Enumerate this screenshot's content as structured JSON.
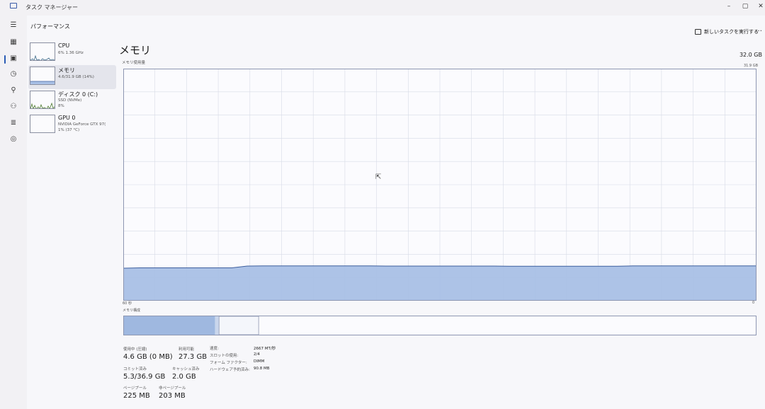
{
  "window": {
    "title": "タスク マネージャー",
    "minimize": "–",
    "maximize": "▢",
    "close": "✕"
  },
  "header": {
    "section": "パフォーマンス",
    "run_task": "新しいタスクを実行する",
    "more": "…"
  },
  "sidebar": {
    "items": [
      {
        "name": "CPU",
        "sub1": "6% 1.36 GHz",
        "sub2": ""
      },
      {
        "name": "メモリ",
        "sub1": "4.6/31.9 GB (14%)",
        "sub2": ""
      },
      {
        "name": "ディスク 0 (C:)",
        "sub1": "SSD (NVMe)",
        "sub2": "8%"
      },
      {
        "name": "GPU 0",
        "sub1": "NVIDIA GeForce GTX 97(",
        "sub2": "1% (37 °C)"
      }
    ]
  },
  "main": {
    "title": "メモリ",
    "usage_label": "メモリ使用量",
    "total": "32.0 GB",
    "max": "31.9 GB",
    "axis_left": "60 秒",
    "axis_right": "0",
    "composition_label": "メモリ構成"
  },
  "stats": {
    "in_use_label": "使用中 (圧縮)",
    "in_use_value": "4.6 GB (0 MB)",
    "available_label": "利用可能",
    "available_value": "27.3 GB",
    "committed_label": "コミット済み",
    "committed_value": "5.3/36.9 GB",
    "cached_label": "キャッシュ済み",
    "cached_value": "2.0 GB",
    "paged_label": "ページプール",
    "paged_value": "225 MB",
    "nonpaged_label": "非ページプール",
    "nonpaged_value": "203 MB"
  },
  "details": {
    "speed_label": "速度:",
    "speed_value": "2667 MT/秒",
    "slots_label": "スロットの使用:",
    "slots_value": "2/4",
    "form_label": "フォーム ファクター:",
    "form_value": "DIMM",
    "reserved_label": "ハードウェア予約済み:",
    "reserved_value": "90.8 MB"
  },
  "colors": {
    "memory_fill": "#a9c0e6",
    "memory_line": "#3d5f9e",
    "in_use_block": "#9fb8e0",
    "grid": "#d7dbe6"
  },
  "chart_data": {
    "type": "area",
    "title": "メモリ使用量",
    "xlabel": "",
    "ylabel": "",
    "x_range_seconds": [
      60,
      0
    ],
    "ylim": [
      0,
      31.9
    ],
    "series": [
      {
        "values": [
          4.4,
          4.45,
          4.45,
          4.45,
          4.45,
          4.45,
          4.45,
          4.45,
          4.7,
          4.72,
          4.72,
          4.72,
          4.72,
          4.72,
          4.72,
          4.72,
          4.72,
          4.7,
          4.7,
          4.7,
          4.7,
          4.7,
          4.7,
          4.7,
          4.7,
          4.68,
          4.68,
          4.68,
          4.68,
          4.68,
          4.68,
          4.68,
          4.68,
          4.72,
          4.72,
          4.72,
          4.72,
          4.72,
          4.72,
          4.72,
          4.72,
          4.72
        ]
      }
    ],
    "composition": {
      "in_use_gb": 4.6,
      "modified_gb": 0.2,
      "standby_gb": 2.0,
      "total_gb": 31.9
    },
    "grid": true
  }
}
